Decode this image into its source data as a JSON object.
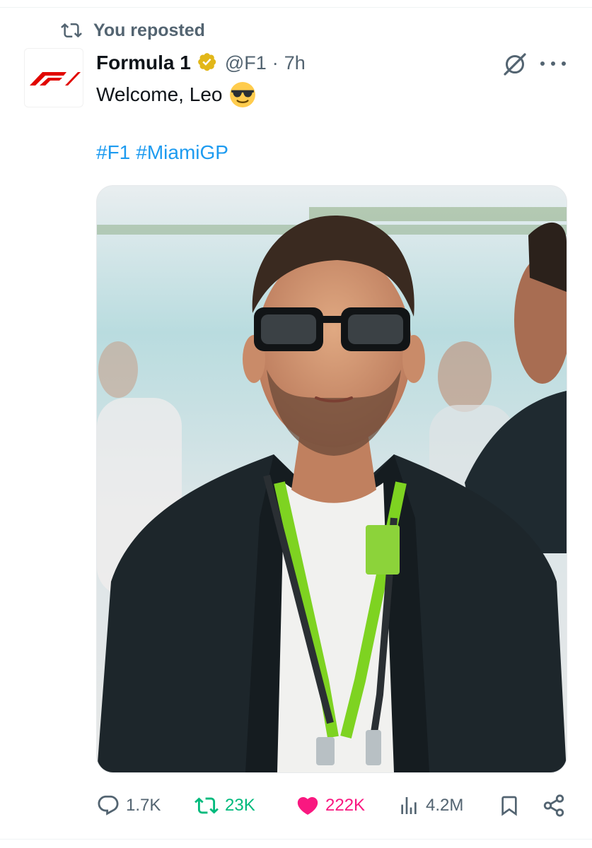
{
  "repost": {
    "icon": "repost-icon",
    "text": "You reposted"
  },
  "author": {
    "name": "Formula 1",
    "verified_icon": "verified-badge-icon",
    "handle": "@F1",
    "separator": "·",
    "time": "7h",
    "avatar_icon": "f1-logo"
  },
  "tweet": {
    "text": "Welcome, Leo",
    "emoji": "smiling-face-with-sunglasses-emoji",
    "hashtags": [
      "#F1",
      "#MiamiGP"
    ]
  },
  "header_icons": {
    "grok": "grok-icon",
    "more": "more-icon"
  },
  "actions": {
    "replies": "1.7K",
    "reposts": "23K",
    "likes": "222K",
    "views": "4.2M",
    "bookmark_icon": "bookmark-icon",
    "share_icon": "share-icon"
  },
  "colors": {
    "accent": "#1d9bf0",
    "muted": "#536471",
    "repost_active": "#00ba7c",
    "like_active": "#f91880",
    "verified_gold": "#e2b719",
    "f1_red": "#e10600"
  }
}
